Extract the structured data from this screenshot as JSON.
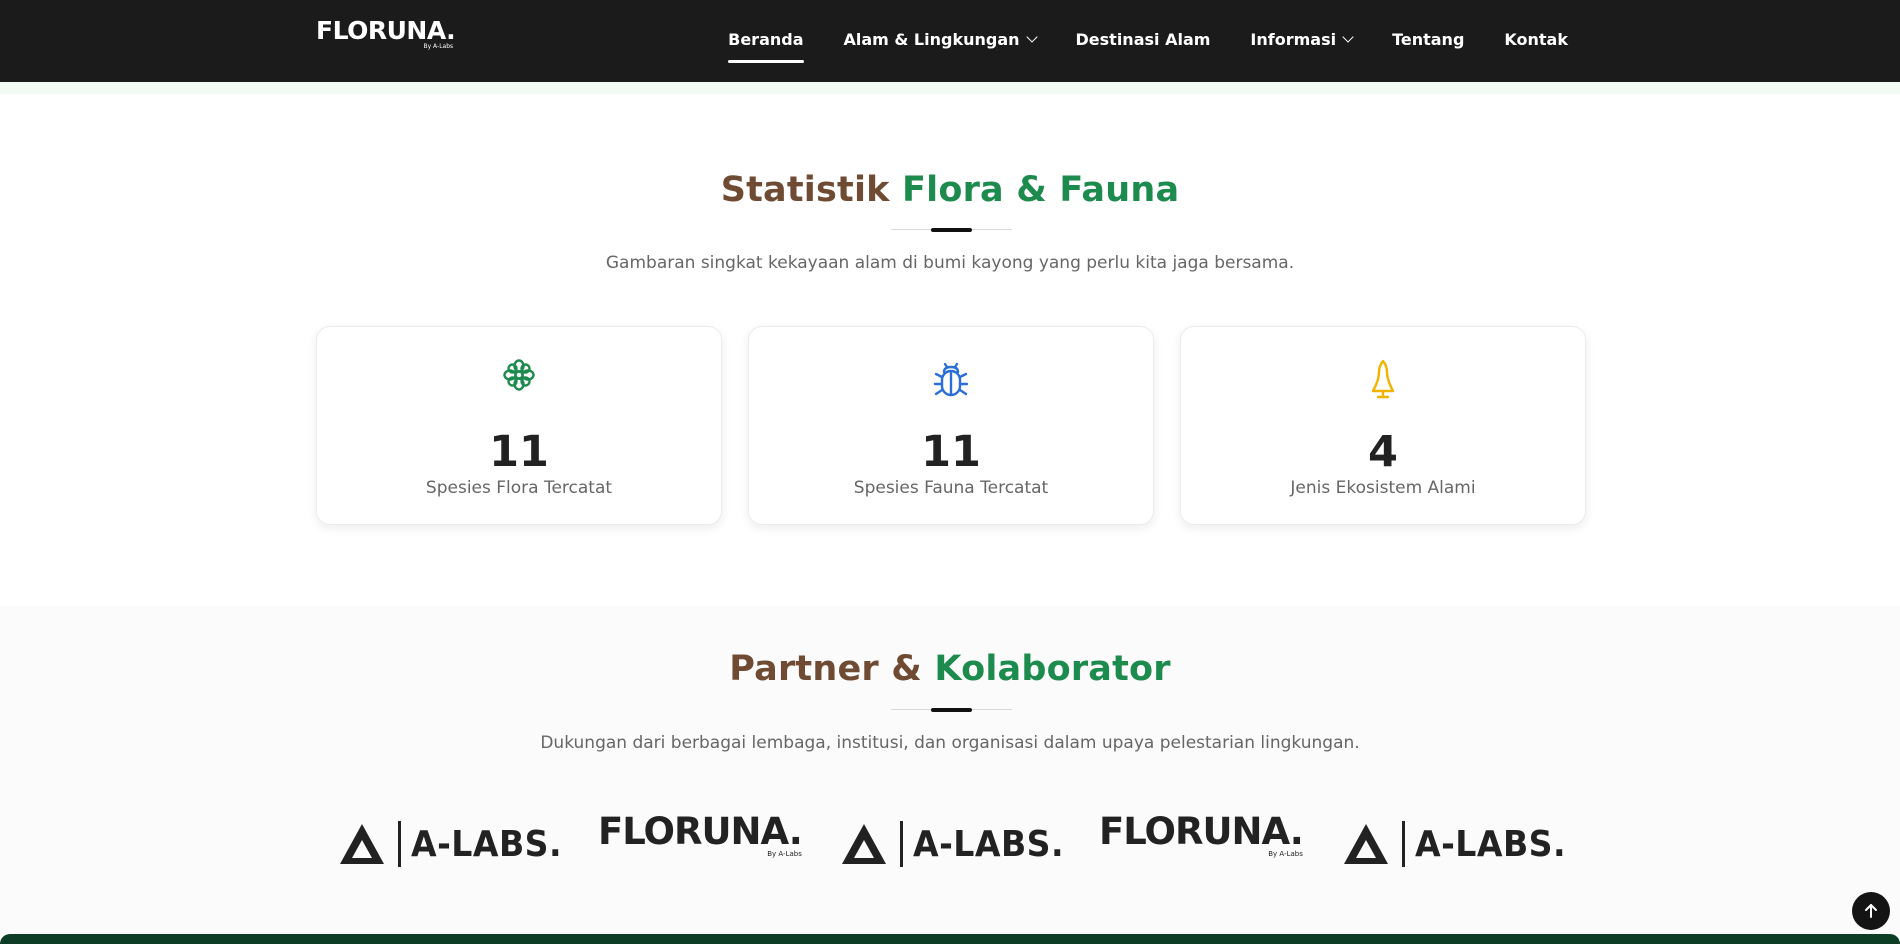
{
  "brand": {
    "name": "FLORUNA.",
    "sub": "By A-Labs"
  },
  "nav": {
    "items": [
      {
        "label": "Beranda",
        "active": true,
        "dropdown": false
      },
      {
        "label": "Alam & Lingkungan",
        "active": false,
        "dropdown": true
      },
      {
        "label": "Destinasi Alam",
        "active": false,
        "dropdown": false
      },
      {
        "label": "Informasi",
        "active": false,
        "dropdown": true
      },
      {
        "label": "Tentang",
        "active": false,
        "dropdown": false
      },
      {
        "label": "Kontak",
        "active": false,
        "dropdown": false
      }
    ]
  },
  "stats": {
    "title_part1": "Statistik",
    "title_part2": "Flora & Fauna",
    "subtitle": "Gambaran singkat kekayaan alam di bumi kayong yang perlu kita jaga bersama.",
    "cards": [
      {
        "icon": "flower-icon",
        "value": "11",
        "label": "Spesies Flora Tercatat",
        "color": "#1d8a4e"
      },
      {
        "icon": "bug-icon",
        "value": "11",
        "label": "Spesies Fauna Tercatat",
        "color": "#2b6fd6"
      },
      {
        "icon": "tree-icon",
        "value": "4",
        "label": "Jenis Ekosistem Alami",
        "color": "#f0b400"
      }
    ]
  },
  "partners": {
    "title_part1": "Partner &",
    "title_part2": "Kolaborator",
    "subtitle": "Dukungan dari berbagai lembaga, institusi, dan organisasi dalam upaya pelestarian lingkungan.",
    "logos": [
      {
        "type": "alabs",
        "text": "A-LABS."
      },
      {
        "type": "floruna",
        "text": "FLORUNA.",
        "sub": "By A-Labs"
      },
      {
        "type": "alabs",
        "text": "A-LABS."
      },
      {
        "type": "floruna",
        "text": "FLORUNA.",
        "sub": "By A-Labs"
      },
      {
        "type": "alabs",
        "text": "A-LABS."
      }
    ]
  },
  "colors": {
    "brown": "#6e4b32",
    "green": "#1d8a4e",
    "nav_bg": "#1b1b1b"
  }
}
